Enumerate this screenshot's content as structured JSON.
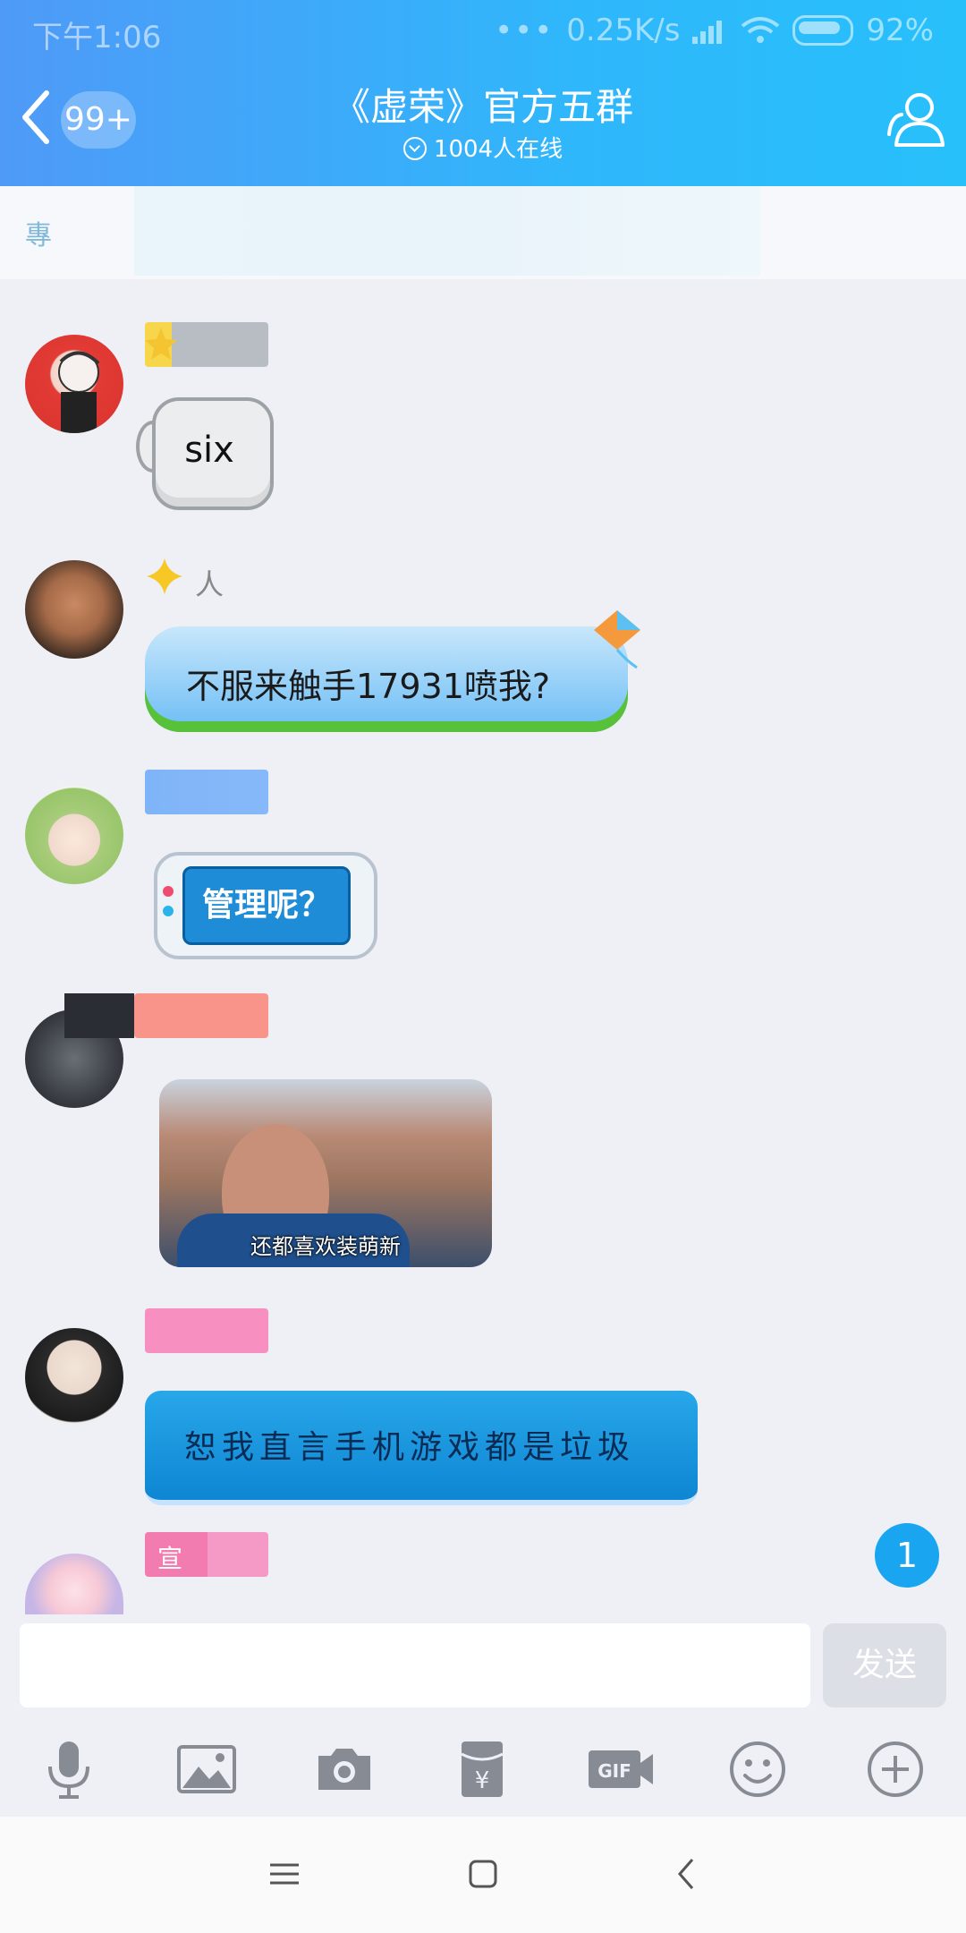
{
  "status_bar": {
    "time": "下午1:06",
    "dots": "•••",
    "speed": "0.25K/s",
    "battery": "92%"
  },
  "header": {
    "unread_badge": "99+",
    "title": "《虚荣》官方五群",
    "online": "1004人在线"
  },
  "notice": {
    "partial_text": "專"
  },
  "messages": [
    {
      "sender": "",
      "content": "six",
      "type": "sticker"
    },
    {
      "sender": "人",
      "content": "不服来触手17931喷我?",
      "type": "bubble"
    },
    {
      "sender": "",
      "content": "管理呢？",
      "type": "sticker"
    },
    {
      "sender": "",
      "content": "还都喜欢装萌新",
      "type": "image"
    },
    {
      "sender": "",
      "content": "恕我直言手机游戏都是垃圾",
      "type": "bubble"
    },
    {
      "sender": "宣",
      "content": "",
      "type": "partial"
    }
  ],
  "new_message_badge": "1",
  "input": {
    "value": "",
    "placeholder": "",
    "send_label": "发送"
  },
  "toolbar": {
    "items": [
      "microphone-icon",
      "image-icon",
      "camera-icon",
      "red-packet-icon",
      "gif-icon",
      "emoji-icon",
      "plus-icon"
    ]
  },
  "colors": {
    "header_start": "#4f9af7",
    "header_end": "#27c0fb",
    "badge": "#1aa5f0"
  }
}
